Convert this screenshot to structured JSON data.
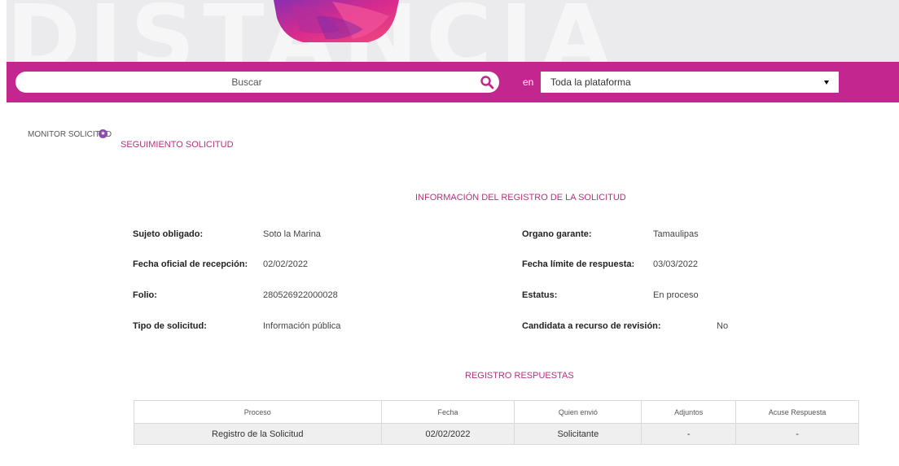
{
  "banner": {
    "background_text": "DISTANCIA"
  },
  "search": {
    "placeholder": "Buscar",
    "scope_label": "en",
    "scope_value": "Toda la plataforma"
  },
  "sidebar": {
    "monitor_label": "MONITOR SOLICITUD",
    "badge": "★"
  },
  "page": {
    "section_title": "SEGUIMIENTO SOLICITUD",
    "info_title": "INFORMACIÓN DEL REGISTRO DE LA SOLICITUD"
  },
  "info": {
    "sujeto_label": "Sujeto obligado:",
    "sujeto_value": "Soto la Marina",
    "fecha_recepcion_label": "Fecha oficial de recepción:",
    "fecha_recepcion_value": "02/02/2022",
    "folio_label": "Folio:",
    "folio_value": "280526922000028",
    "tipo_label": "Tipo de solicitud:",
    "tipo_value": "Información pública",
    "organo_label": "Organo garante:",
    "organo_value": "Tamaulipas",
    "fecha_limite_label": "Fecha límite de respuesta:",
    "fecha_limite_value": "03/03/2022",
    "estatus_label": "Estatus:",
    "estatus_value": "En proceso",
    "candidata_label": "Candidata a recurso de revisión:",
    "candidata_value": "No"
  },
  "responses": {
    "title": "REGISTRO RESPUESTAS",
    "columns": [
      "Proceso",
      "Fecha",
      "Quien envió",
      "Adjuntos",
      "Acuse Respuesta"
    ],
    "rows": [
      [
        "Registro de la Solicitud",
        "02/02/2022",
        "Solicitante",
        "-",
        "-"
      ]
    ]
  },
  "colors": {
    "brand": "#c3268f",
    "accent_text": "#b5307f"
  }
}
